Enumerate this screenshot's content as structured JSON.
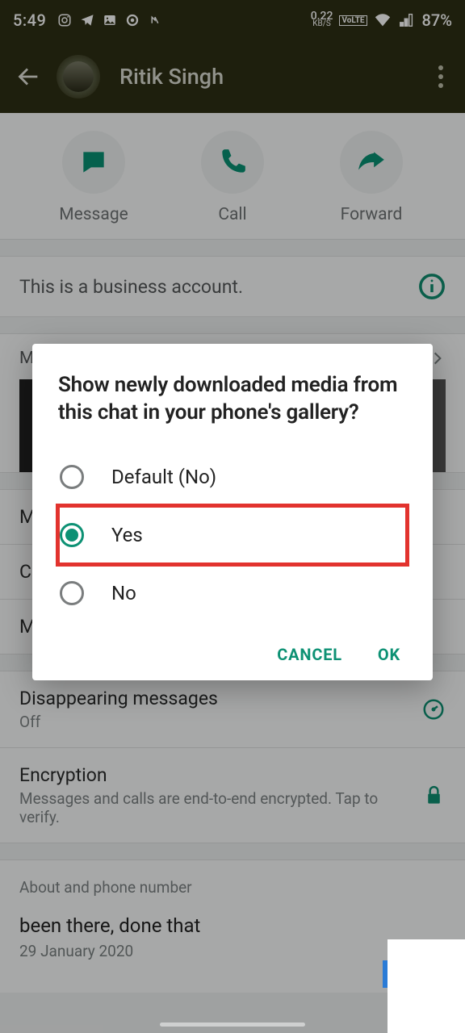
{
  "status": {
    "time": "5:49",
    "kbps_value": "0.22",
    "kbps_label": "KB/S",
    "lte": "VoLTE",
    "battery_pct": "87%"
  },
  "header": {
    "contact_name": "Ritik Singh"
  },
  "actions": {
    "message": "Message",
    "call": "Call",
    "forward": "Forward"
  },
  "business_notice": "This is a business account.",
  "media": {
    "header": "Media, links, and docs"
  },
  "settings": {
    "mute_label": "Mute notifications",
    "custom_label": "Custom notifications",
    "media_vis_label": "Media visibility",
    "disappearing_label": "Disappearing messages",
    "disappearing_value": "Off",
    "encryption_label": "Encryption",
    "encryption_sub": "Messages and calls are end-to-end encrypted. Tap to verify."
  },
  "about": {
    "section_label": "About and phone number",
    "bio": "been there, done that",
    "date": "29 January 2020"
  },
  "dialog": {
    "title": "Show newly downloaded media from this chat in your phone's gallery?",
    "options": {
      "default": "Default (No)",
      "yes": "Yes",
      "no": "No"
    },
    "selected": "yes",
    "cancel": "CANCEL",
    "ok": "OK"
  }
}
